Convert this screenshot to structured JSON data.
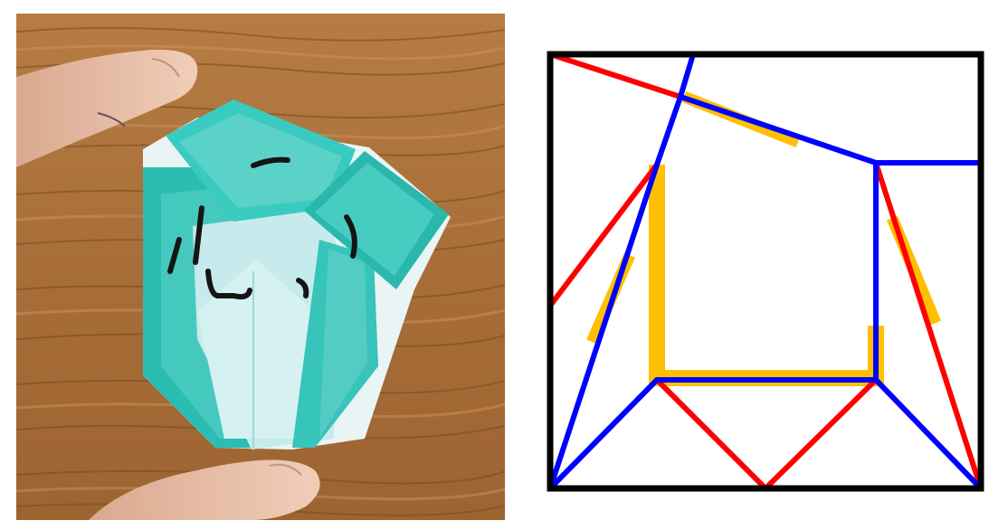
{
  "photo": {
    "marker_colors": {
      "wood_dark": "#7a4a22",
      "wood_light": "#c08a52",
      "teal": "#3fc9c0",
      "teal_light": "#9fe3dc",
      "pale_cyan": "#cfeef0",
      "skin": "#e8bfa8",
      "ink": "#151515"
    }
  },
  "diagram": {
    "colors": {
      "border": "#000000",
      "mountain": "#ff0000",
      "valley": "#0000ff",
      "highlight": "#ffc000"
    },
    "legend": []
  }
}
